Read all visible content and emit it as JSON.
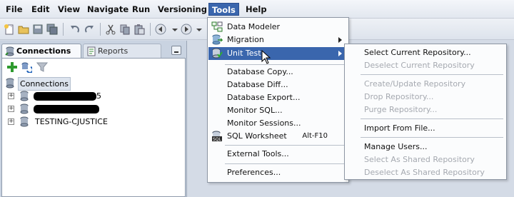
{
  "menubar": {
    "items": [
      "File",
      "Edit",
      "View",
      "Navigate",
      "Run",
      "Versioning",
      "Tools",
      "Help"
    ],
    "active": "Tools"
  },
  "toolbar": {
    "icons": [
      "new-icon",
      "open-icon",
      "save-icon",
      "save-all-icon",
      "undo-icon",
      "redo-icon",
      "cut-icon",
      "copy-icon",
      "paste-icon",
      "back-icon",
      "forward-icon"
    ]
  },
  "panel": {
    "tabs": [
      "Connections",
      "Reports"
    ],
    "active_tab": "Connections",
    "tools": [
      "add-connection-icon",
      "refresh-icon",
      "filter-icon"
    ],
    "tree": {
      "root": "Connections",
      "children": [
        {
          "label": "",
          "redacted": true,
          "visible_tail": "5"
        },
        {
          "label": "",
          "redacted": true
        },
        {
          "label": "TESTING-CJUSTICE",
          "redacted": false
        }
      ]
    }
  },
  "tools_menu": {
    "items": [
      {
        "label": "Data Modeler",
        "icon": "data-modeler-icon",
        "submenu": false
      },
      {
        "label": "Migration",
        "icon": "migration-icon",
        "submenu": true
      },
      {
        "label": "Unit Test",
        "icon": "unit-test-icon",
        "submenu": true,
        "highlighted": true
      },
      {
        "label": "Database Copy...",
        "submenu": false
      },
      {
        "label": "Database Diff...",
        "submenu": false
      },
      {
        "label": "Database Export...",
        "submenu": false
      },
      {
        "label": "Monitor SQL...",
        "submenu": false
      },
      {
        "label": "Monitor Sessions...",
        "submenu": false
      },
      {
        "label": "SQL Worksheet",
        "icon": "sql-worksheet-icon",
        "accelerator": "Alt-F10"
      },
      {
        "label": "External Tools..."
      },
      {
        "label": "Preferences..."
      }
    ]
  },
  "unit_test_menu": {
    "items": [
      {
        "label": "Select Current Repository...",
        "enabled": true
      },
      {
        "label": "Deselect Current Repository",
        "enabled": false
      },
      {
        "label": "Create/Update Repository",
        "enabled": false
      },
      {
        "label": "Drop Repository...",
        "enabled": false
      },
      {
        "label": "Purge Repository...",
        "enabled": false
      },
      {
        "label": "Import From File...",
        "enabled": true
      },
      {
        "label": "Manage Users...",
        "enabled": true
      },
      {
        "label": "Select As Shared Repository",
        "enabled": false
      },
      {
        "label": "Deselect As Shared Repository",
        "enabled": false
      }
    ]
  },
  "colors": {
    "highlight": "#3a66ad",
    "disabled_text": "#a5a9b0",
    "panel_bg": "#c9d3e1"
  }
}
